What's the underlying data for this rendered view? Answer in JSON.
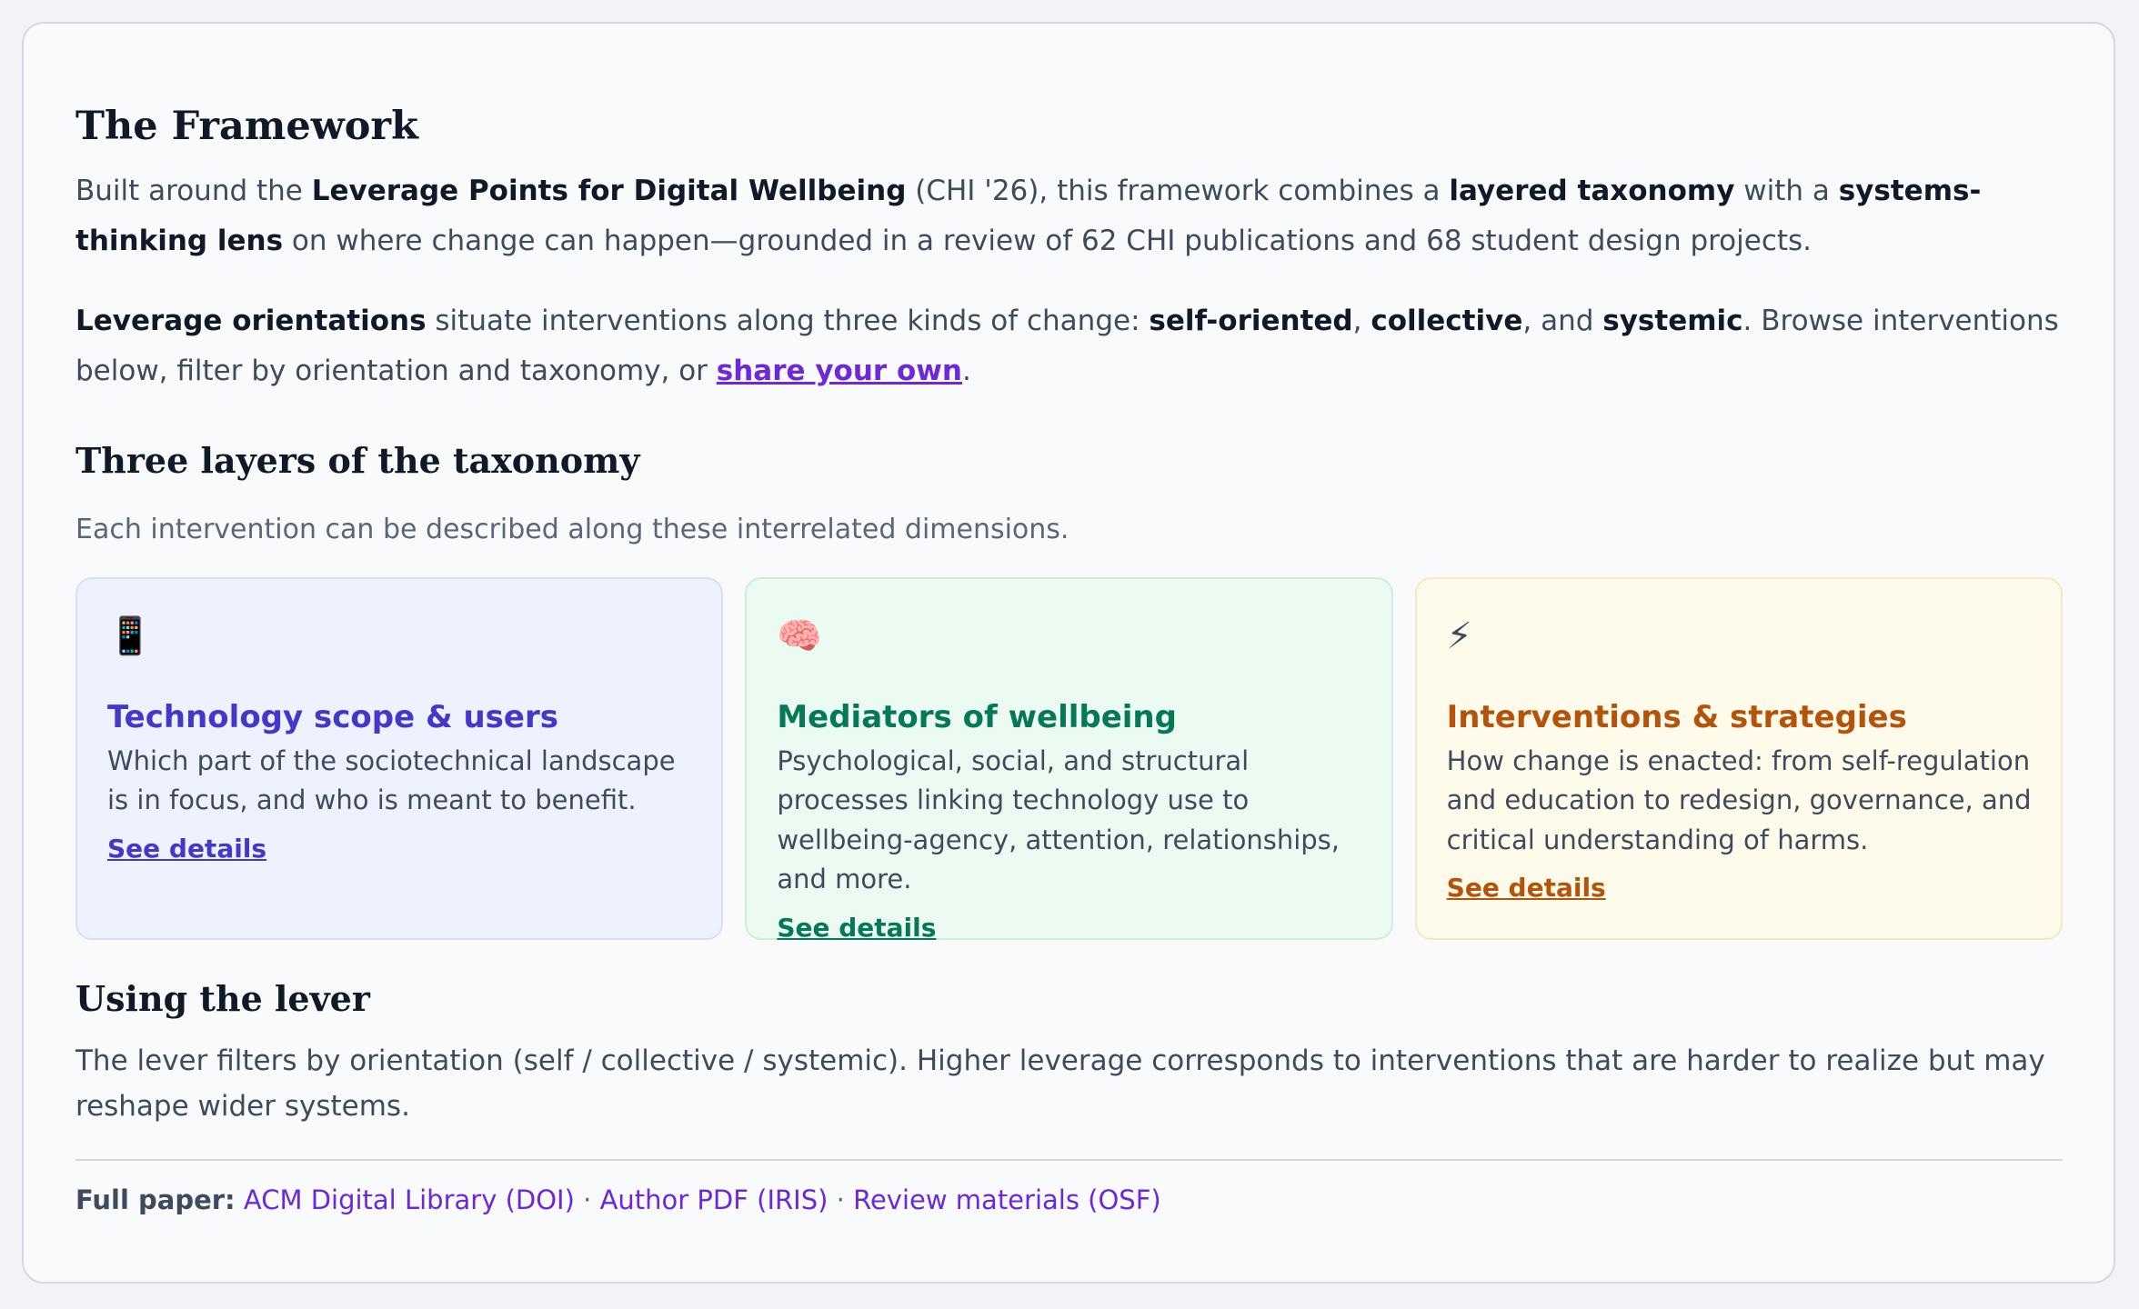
{
  "framework": {
    "title": "The Framework",
    "intro": {
      "t1": "Built around the ",
      "b1": "Leverage Points for Digital Wellbeing",
      "t2": " (CHI '26), this framework combines a ",
      "b2": "layered taxonomy",
      "t3": " with a ",
      "b3": "systems-thinking lens",
      "t4": " on where change can happen—grounded in a review of 62 CHI publications and 68 student design projects."
    },
    "orientations": {
      "b1": "Leverage orientations",
      "t1": " situate interventions along three kinds of change: ",
      "b2": "self-oriented",
      "t2": ", ",
      "b3": "collective",
      "t3": ", and ",
      "b4": "systemic",
      "t4": ". Browse interventions below, filter by orientation and taxonomy, or ",
      "link": "share your own",
      "t5": "."
    }
  },
  "taxonomy": {
    "title": "Three layers of the taxonomy",
    "subtitle": "Each intervention can be described along these interrelated dimensions.",
    "cards": [
      {
        "icon": "📱",
        "icon_name": "mobile-phone-icon",
        "title": "Technology scope & users",
        "description": "Which part of the sociotechnical landscape is in focus, and who is meant to benefit.",
        "link": "See details",
        "accent": "#4338ca"
      },
      {
        "icon": "🧠",
        "icon_name": "brain-icon",
        "title": "Mediators of wellbeing",
        "description": "Psychological, social, and structural processes linking technology use to wellbeing-agency, attention, relationships, and more.",
        "link": "See details",
        "accent": "#047857"
      },
      {
        "icon": "⚡",
        "icon_name": "lightning-icon",
        "title": "Interventions & strategies",
        "description": "How change is enacted: from self-regulation and education to redesign, governance, and critical understanding of harms.",
        "link": "See details",
        "accent": "#b45309"
      }
    ]
  },
  "lever": {
    "title": "Using the lever",
    "text": "The lever filters by orientation (self / collective / systemic). Higher leverage corresponds to interventions that are harder to realize but may reshape wider systems."
  },
  "footer": {
    "label": "Full paper:",
    "links": [
      "ACM Digital Library (DOI)",
      "Author PDF (IRIS)",
      "Review materials (OSF)"
    ],
    "separator": " · "
  }
}
